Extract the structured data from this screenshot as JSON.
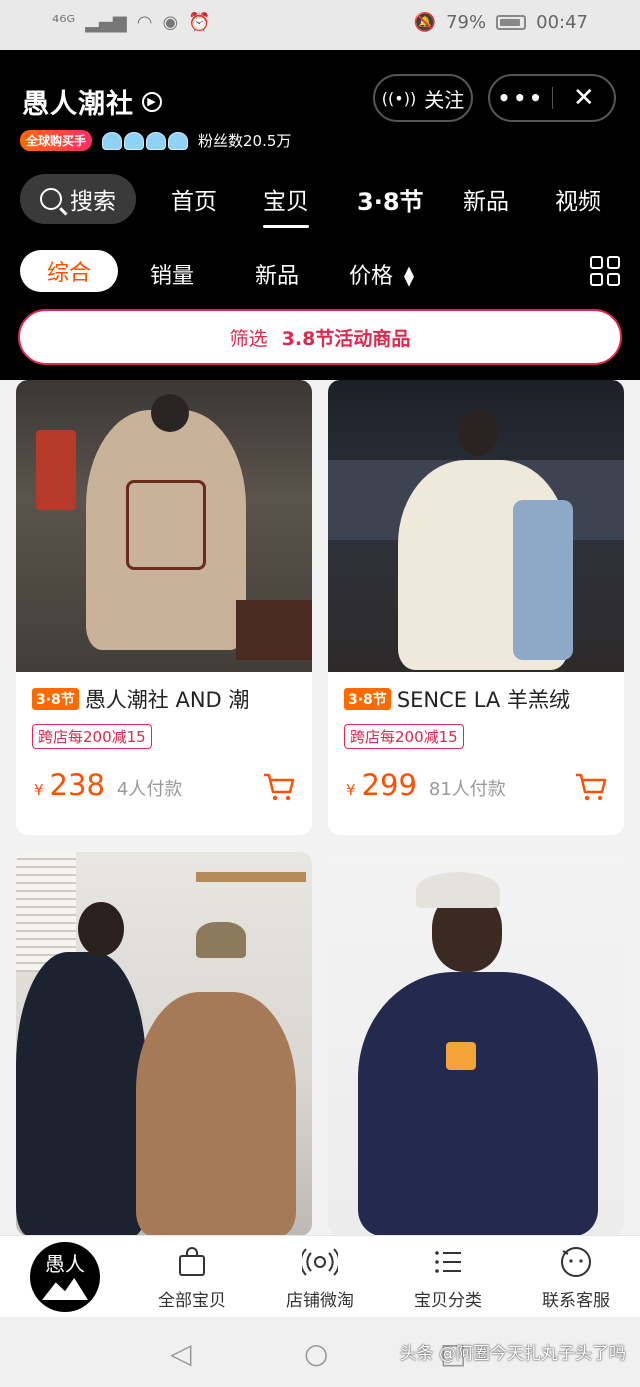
{
  "status_bar": {
    "signal": "⁴⁶ᴳ",
    "battery": "79%",
    "battery_level": 0.79,
    "time": "00:47"
  },
  "header": {
    "shop_name": "愚人潮社",
    "follow_label": "关注",
    "more_label": "•••",
    "close_label": "✕",
    "global_badge": "全球购买手",
    "fans": "粉丝数20.5万",
    "search_label": "搜索",
    "tabs": [
      "首页",
      "宝贝",
      "3·8节",
      "新品",
      "视频"
    ],
    "active_tab": "宝贝"
  },
  "sort": {
    "active": "综合",
    "items": [
      "销量",
      "新品",
      "价格"
    ]
  },
  "filter": {
    "label": "筛选",
    "highlight": "3.8节活动商品"
  },
  "products": [
    {
      "tag": "3·8节",
      "title": "愚人潮社 AND 潮",
      "promo": "跨店每200减15",
      "currency": "¥",
      "price": "238",
      "paid": "4人付款"
    },
    {
      "tag": "3·8节",
      "title": "SENCE LA 羊羔绒",
      "promo": "跨店每200减15",
      "currency": "¥",
      "price": "299",
      "paid": "81人付款"
    },
    {
      "tag": "",
      "title": "",
      "promo": "",
      "currency": "",
      "price": "",
      "paid": ""
    },
    {
      "tag": "",
      "title": "",
      "promo": "",
      "currency": "",
      "price": "",
      "paid": ""
    }
  ],
  "bottom_nav": {
    "logo_text": "愚人",
    "items": [
      "全部宝贝",
      "店铺微淘",
      "宝贝分类",
      "联系客服"
    ]
  },
  "watermark": "头条 @阿圈今天扎丸子头了吗",
  "colors": {
    "accent": "#ff5000",
    "filter_red": "#e0284e",
    "header_bg": "#000000"
  }
}
